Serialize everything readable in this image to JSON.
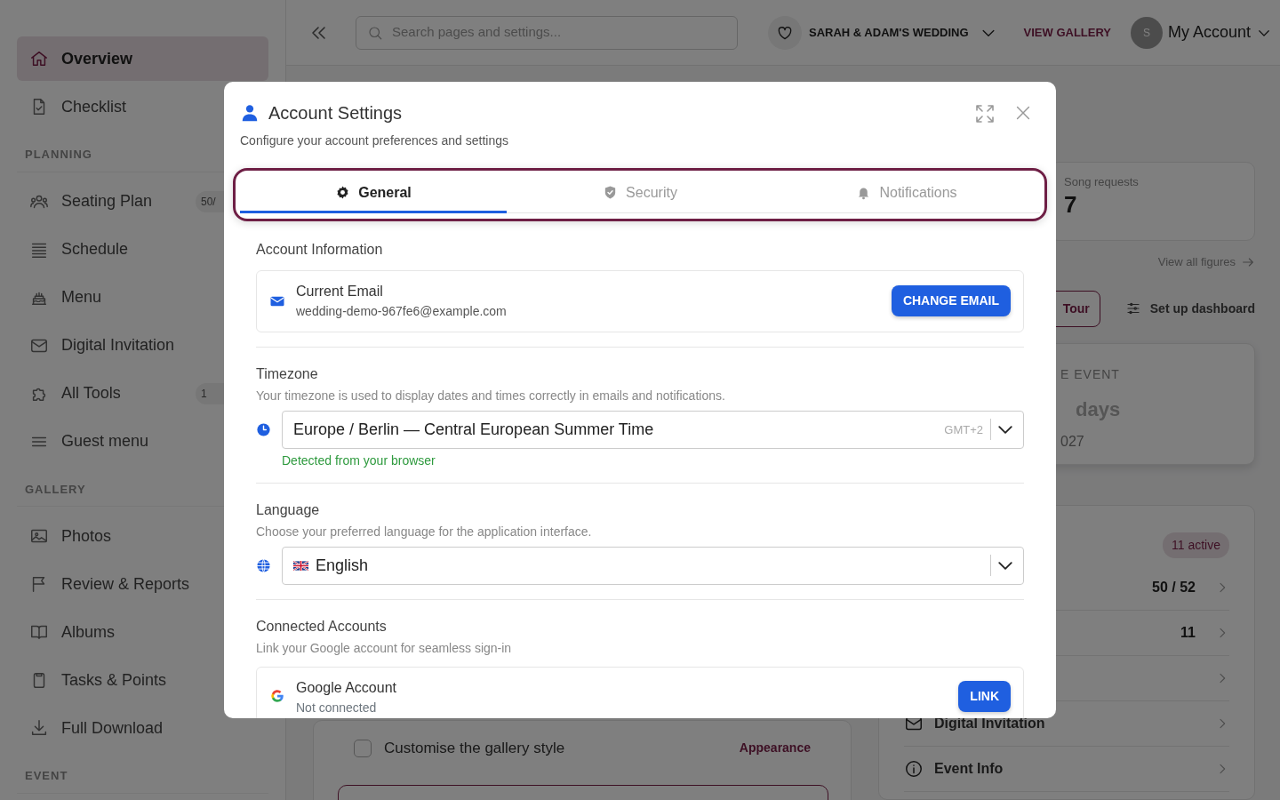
{
  "sidebar": {
    "sections": [
      {
        "items": [
          {
            "label": "Overview",
            "selected": true
          },
          {
            "label": "Checklist",
            "selected": false
          }
        ]
      },
      {
        "heading": "PLANNING",
        "items": [
          {
            "label": "Seating Plan",
            "selected": false,
            "badge": "50/"
          },
          {
            "label": "Schedule",
            "selected": false
          },
          {
            "label": "Menu",
            "selected": false
          },
          {
            "label": "Digital Invitation",
            "selected": false
          },
          {
            "label": "All Tools",
            "selected": false,
            "badge": "1"
          },
          {
            "label": "Guest menu",
            "selected": false
          }
        ]
      },
      {
        "heading": "GALLERY",
        "items": [
          {
            "label": "Photos",
            "selected": false
          },
          {
            "label": "Review & Reports",
            "selected": false
          },
          {
            "label": "Albums",
            "selected": false
          },
          {
            "label": "Tasks & Points",
            "selected": false
          },
          {
            "label": "Full Download",
            "selected": false
          }
        ]
      },
      {
        "heading": "EVENT"
      }
    ]
  },
  "topbar": {
    "search_placeholder": "Search pages and settings...",
    "event_name": "SARAH & ADAM'S WEDDING",
    "gallery_link": "VIEW GALLERY",
    "avatar_initial": "S",
    "account_label": "My Account"
  },
  "dashboard": {
    "stat_card": {
      "label": "Song requests",
      "value": "7"
    },
    "view_all": "View all figures",
    "actions": [
      {
        "kind": "outline",
        "label": "Tour"
      },
      {
        "kind": "plain",
        "label": "Set up dashboard"
      }
    ],
    "event_card": {
      "label": "E EVENT",
      "unit": "days",
      "date": "027"
    },
    "overview_card": {
      "badge": "11 active",
      "rows": [
        {
          "kind": "count",
          "value": "50 / 52"
        },
        {
          "kind": "count",
          "value": "11"
        },
        {
          "kind": "blank"
        },
        {
          "kind": "link",
          "label": "Digital Invitation"
        },
        {
          "kind": "link",
          "label": "Event Info"
        }
      ]
    },
    "checklist": {
      "task": {
        "label": "Customise the gallery style",
        "checked": false,
        "link": "Appearance"
      }
    }
  },
  "modal": {
    "title": "Account Settings",
    "subtitle": "Configure your account preferences and settings",
    "tabs": [
      {
        "label": "General",
        "selected": true
      },
      {
        "label": "Security",
        "selected": false
      },
      {
        "label": "Notifications",
        "selected": false
      }
    ],
    "account": {
      "heading": "Account Information",
      "email_label": "Current Email",
      "email": "wedding-demo-967fe6@example.com",
      "button": "CHANGE EMAIL"
    },
    "timezone": {
      "heading": "Timezone",
      "description": "Your timezone is used to display dates and times correctly in emails and notifications.",
      "value": "Europe / Berlin — Central European Summer Time",
      "offset": "GMT+2",
      "hint": "Detected from your browser"
    },
    "language": {
      "heading": "Language",
      "description": "Choose your preferred language for the application interface.",
      "value": "English"
    },
    "connected": {
      "heading": "Connected Accounts",
      "description": "Link your Google account for seamless sign-in",
      "account_name": "Google Account",
      "status": "Not connected",
      "button": "LINK"
    }
  }
}
